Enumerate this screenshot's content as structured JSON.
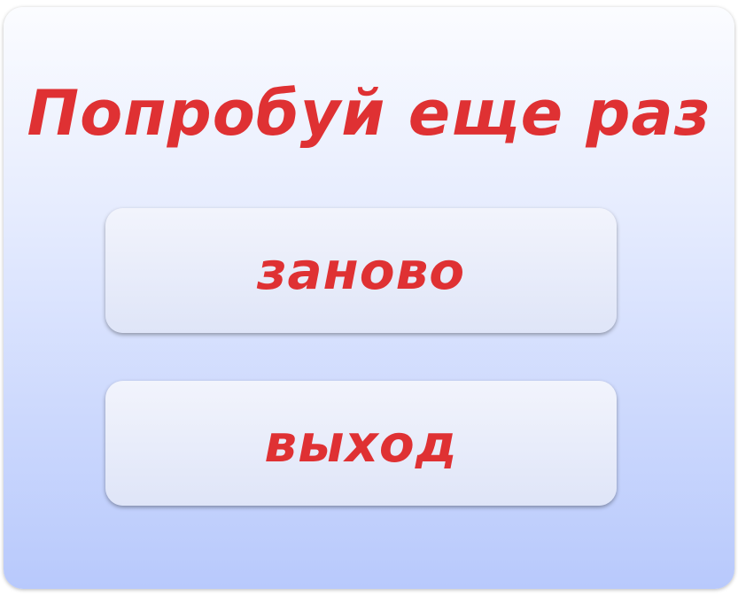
{
  "dialog": {
    "title": "Попробуй еще раз",
    "buttons": {
      "retry": {
        "label": "заново"
      },
      "exit": {
        "label": "выход"
      }
    }
  },
  "colors": {
    "text_accent": "#df3133",
    "panel_top": "#fbfcff",
    "panel_bottom": "#b8c9fc",
    "button_bg": "#e8ecfa"
  }
}
